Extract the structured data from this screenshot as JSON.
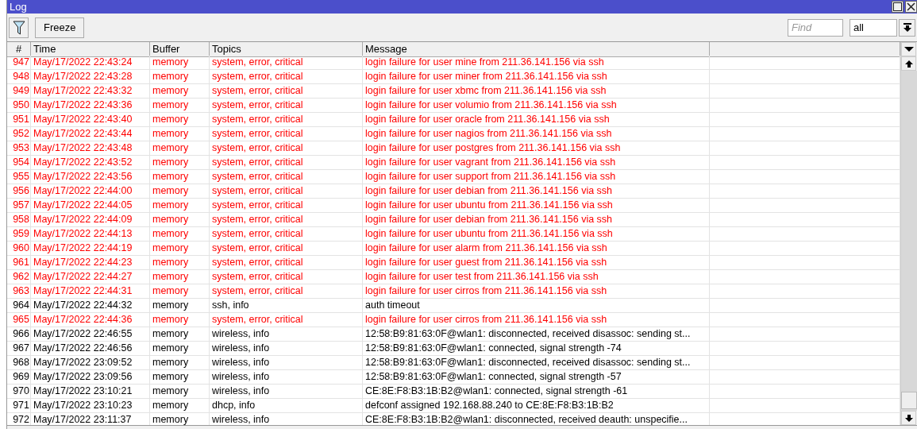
{
  "window": {
    "title": "Log"
  },
  "toolbar": {
    "freeze_button": "Freeze",
    "find": {
      "placeholder": "Find"
    },
    "filter_select": {
      "value": "all"
    }
  },
  "table": {
    "columns": [
      "#",
      "Time",
      "Buffer",
      "Topics",
      "Message"
    ],
    "rows": [
      {
        "kind": "error",
        "num": "947",
        "time": "May/17/2022 22:43:24",
        "buffer": "memory",
        "topics": "system, error, critical",
        "message": "login failure for user mine from 211.36.141.156 via ssh"
      },
      {
        "kind": "error",
        "num": "948",
        "time": "May/17/2022 22:43:28",
        "buffer": "memory",
        "topics": "system, error, critical",
        "message": "login failure for user miner from 211.36.141.156 via ssh"
      },
      {
        "kind": "error",
        "num": "949",
        "time": "May/17/2022 22:43:32",
        "buffer": "memory",
        "topics": "system, error, critical",
        "message": "login failure for user xbmc from 211.36.141.156 via ssh"
      },
      {
        "kind": "error",
        "num": "950",
        "time": "May/17/2022 22:43:36",
        "buffer": "memory",
        "topics": "system, error, critical",
        "message": "login failure for user volumio from 211.36.141.156 via ssh"
      },
      {
        "kind": "error",
        "num": "951",
        "time": "May/17/2022 22:43:40",
        "buffer": "memory",
        "topics": "system, error, critical",
        "message": "login failure for user oracle from 211.36.141.156 via ssh"
      },
      {
        "kind": "error",
        "num": "952",
        "time": "May/17/2022 22:43:44",
        "buffer": "memory",
        "topics": "system, error, critical",
        "message": "login failure for user nagios from 211.36.141.156 via ssh"
      },
      {
        "kind": "error",
        "num": "953",
        "time": "May/17/2022 22:43:48",
        "buffer": "memory",
        "topics": "system, error, critical",
        "message": "login failure for user postgres from 211.36.141.156 via ssh"
      },
      {
        "kind": "error",
        "num": "954",
        "time": "May/17/2022 22:43:52",
        "buffer": "memory",
        "topics": "system, error, critical",
        "message": "login failure for user vagrant from 211.36.141.156 via ssh"
      },
      {
        "kind": "error",
        "num": "955",
        "time": "May/17/2022 22:43:56",
        "buffer": "memory",
        "topics": "system, error, critical",
        "message": "login failure for user support from 211.36.141.156 via ssh"
      },
      {
        "kind": "error",
        "num": "956",
        "time": "May/17/2022 22:44:00",
        "buffer": "memory",
        "topics": "system, error, critical",
        "message": "login failure for user debian from 211.36.141.156 via ssh"
      },
      {
        "kind": "error",
        "num": "957",
        "time": "May/17/2022 22:44:05",
        "buffer": "memory",
        "topics": "system, error, critical",
        "message": "login failure for user ubuntu from 211.36.141.156 via ssh"
      },
      {
        "kind": "error",
        "num": "958",
        "time": "May/17/2022 22:44:09",
        "buffer": "memory",
        "topics": "system, error, critical",
        "message": "login failure for user debian from 211.36.141.156 via ssh"
      },
      {
        "kind": "error",
        "num": "959",
        "time": "May/17/2022 22:44:13",
        "buffer": "memory",
        "topics": "system, error, critical",
        "message": "login failure for user ubuntu from 211.36.141.156 via ssh"
      },
      {
        "kind": "error",
        "num": "960",
        "time": "May/17/2022 22:44:19",
        "buffer": "memory",
        "topics": "system, error, critical",
        "message": "login failure for user alarm from 211.36.141.156 via ssh"
      },
      {
        "kind": "error",
        "num": "961",
        "time": "May/17/2022 22:44:23",
        "buffer": "memory",
        "topics": "system, error, critical",
        "message": "login failure for user guest from 211.36.141.156 via ssh"
      },
      {
        "kind": "error",
        "num": "962",
        "time": "May/17/2022 22:44:27",
        "buffer": "memory",
        "topics": "system, error, critical",
        "message": "login failure for user test from 211.36.141.156 via ssh"
      },
      {
        "kind": "error",
        "num": "963",
        "time": "May/17/2022 22:44:31",
        "buffer": "memory",
        "topics": "system, error, critical",
        "message": "login failure for user cirros from 211.36.141.156 via ssh"
      },
      {
        "kind": "info",
        "num": "964",
        "time": "May/17/2022 22:44:32",
        "buffer": "memory",
        "topics": "ssh, info",
        "message": "auth timeout"
      },
      {
        "kind": "error",
        "num": "965",
        "time": "May/17/2022 22:44:36",
        "buffer": "memory",
        "topics": "system, error, critical",
        "message": "login failure for user cirros from 211.36.141.156 via ssh"
      },
      {
        "kind": "info",
        "num": "966",
        "time": "May/17/2022 22:46:55",
        "buffer": "memory",
        "topics": "wireless, info",
        "message": "12:58:B9:81:63:0F@wlan1: disconnected, received disassoc: sending st..."
      },
      {
        "kind": "info",
        "num": "967",
        "time": "May/17/2022 22:46:56",
        "buffer": "memory",
        "topics": "wireless, info",
        "message": "12:58:B9:81:63:0F@wlan1: connected, signal strength -74"
      },
      {
        "kind": "info",
        "num": "968",
        "time": "May/17/2022 23:09:52",
        "buffer": "memory",
        "topics": "wireless, info",
        "message": "12:58:B9:81:63:0F@wlan1: disconnected, received disassoc: sending st..."
      },
      {
        "kind": "info",
        "num": "969",
        "time": "May/17/2022 23:09:56",
        "buffer": "memory",
        "topics": "wireless, info",
        "message": "12:58:B9:81:63:0F@wlan1: connected, signal strength -57"
      },
      {
        "kind": "info",
        "num": "970",
        "time": "May/17/2022 23:10:21",
        "buffer": "memory",
        "topics": "wireless, info",
        "message": "CE:8E:F8:B3:1B:B2@wlan1: connected, signal strength -61"
      },
      {
        "kind": "info",
        "num": "971",
        "time": "May/17/2022 23:10:23",
        "buffer": "memory",
        "topics": "dhcp, info",
        "message": "defconf assigned 192.168.88.240 to CE:8E:F8:B3:1B:B2"
      },
      {
        "kind": "info",
        "num": "972",
        "time": "May/17/2022 23:11:37",
        "buffer": "memory",
        "topics": "wireless, info",
        "message": "CE:8E:F8:B3:1B:B2@wlan1: disconnected, received deauth: unspecifie..."
      }
    ]
  }
}
